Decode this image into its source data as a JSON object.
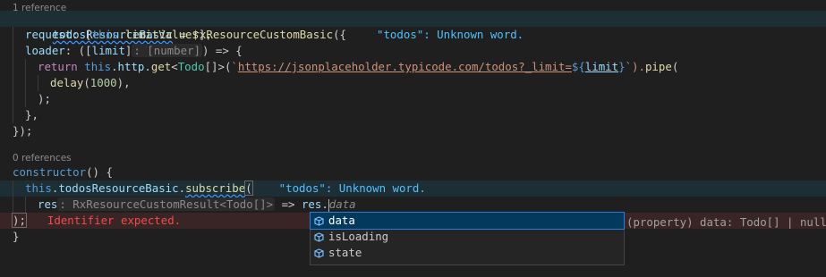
{
  "lens": {
    "ref1": "1 reference",
    "ref0": "0 references"
  },
  "lines": {
    "l1_name": "todosResourceBasic",
    "l1_eq": " = ",
    "l1_fn": "rxResourceCustomBasic",
    "l1_paren": "({",
    "l1_diag": "\"todos\": Unknown word.",
    "l2_key": "request",
    "l2_rest_a": ": [",
    "l2_this": "this",
    "l2_dot": ".",
    "l2_fn": "limitValue$",
    "l2_rest_b": "],",
    "l3_key": "loader",
    "l3_a": ": ([",
    "l3_param": "limit",
    "l3_b": "]",
    "l3_inlay": ": [number]",
    "l3_c": ") => {",
    "l4_return": "return",
    "l4_this": "this",
    "l4_http": "http",
    "l4_get": "get",
    "l4_lt": "<",
    "l4_type": "Todo",
    "l4_gt": "[]>(",
    "l4_tick": "`",
    "l4_url": "https://jsonplaceholder.typicode.com/todos?_limit=",
    "l4_tpl_open": "${",
    "l4_tpl_var": "limit",
    "l4_tpl_close": "}",
    "l4_end": "`).",
    "l4_pipe": "pipe",
    "l4_paren": "(",
    "l5_fn": "delay",
    "l5_num": "1000",
    "l5_rest": "),",
    "l6": ");",
    "l7": "},",
    "l8": "});",
    "l10_kw": "constructor",
    "l10_rest": "() {",
    "l11_this": "this",
    "l11_prop": "todosResourceBasic",
    "l11_sub": "subscribe",
    "l11_paren": "(",
    "l11_diag": "\"todos\": Unknown word.",
    "l12_res": "res",
    "l12_inlay": ": RxResourceCustomResult<Todo[]>",
    "l12_arrow": " => ",
    "l12_res2": "res.",
    "l12_ghost": "data",
    "l13_code": ");",
    "l13_err": "Identifier expected.",
    "l14": "}"
  },
  "suggest": {
    "items": [
      {
        "label": "data",
        "icon": "property-icon"
      },
      {
        "label": "isLoading",
        "icon": "property-icon"
      },
      {
        "label": "state",
        "icon": "property-icon"
      }
    ],
    "detail": "(property) data: Todo[] | null"
  },
  "colors": {
    "background": "#1f1f1f",
    "keyword": "#569cd6",
    "string": "#ce9178",
    "function": "#dcdcaa",
    "type": "#4ec9b0",
    "error": "#f14c4c",
    "selection": "#04395e"
  }
}
